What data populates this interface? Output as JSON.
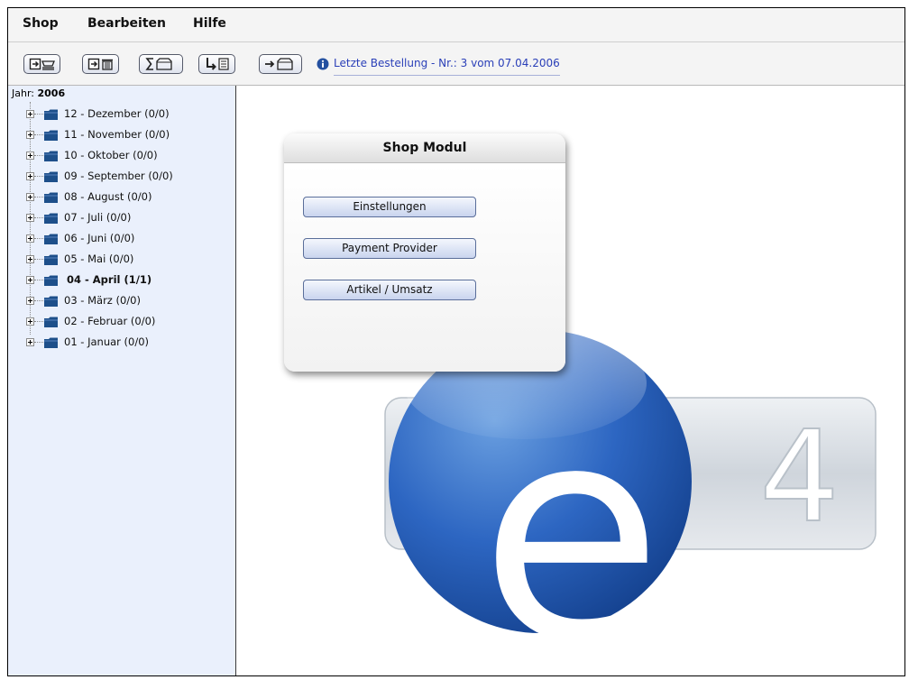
{
  "menu": {
    "items": [
      "Shop",
      "Bearbeiten",
      "Hilfe"
    ]
  },
  "toolbar": {
    "buttons": [
      {
        "icon": "import-cart-icon"
      },
      {
        "icon": "import-delete-icon"
      },
      {
        "icon": "sum-bag-icon"
      },
      {
        "icon": "down-document-icon"
      },
      {
        "icon": "arrow-bag-icon"
      }
    ],
    "info_icon": "info-icon",
    "last_order": "Letzte Bestellung - Nr.: 3 vom 07.04.2006"
  },
  "sidebar": {
    "year_prefix": "Jahr:",
    "year": "2006",
    "months": [
      {
        "label": "12 - Dezember (0/0)",
        "bold": false
      },
      {
        "label": "11 - November (0/0)",
        "bold": false
      },
      {
        "label": "10 - Oktober (0/0)",
        "bold": false
      },
      {
        "label": "09 - September (0/0)",
        "bold": false
      },
      {
        "label": "08 - August (0/0)",
        "bold": false
      },
      {
        "label": "07 - Juli (0/0)",
        "bold": false
      },
      {
        "label": "06 - Juni (0/0)",
        "bold": false
      },
      {
        "label": "05 - Mai (0/0)",
        "bold": false
      },
      {
        "label": "04 - April (1/1)",
        "bold": true
      },
      {
        "label": "03 - März (0/0)",
        "bold": false
      },
      {
        "label": "02 - Februar (0/0)",
        "bold": false
      },
      {
        "label": "01 - Januar (0/0)",
        "bold": false
      }
    ]
  },
  "panel": {
    "title": "Shop Modul",
    "buttons": [
      "Einstellungen",
      "Payment Provider",
      "Artikel / Umsatz"
    ]
  },
  "logo": {
    "letter": "e",
    "number": "4",
    "colors": {
      "circle": "#1f55b0",
      "bar": "#c9d0d8"
    }
  }
}
